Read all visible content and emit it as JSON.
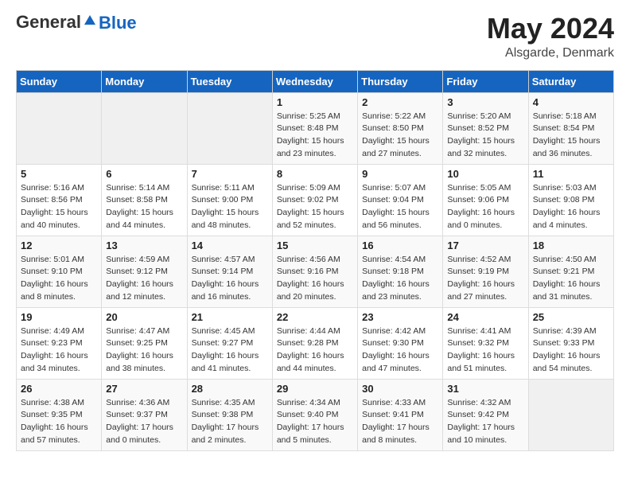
{
  "header": {
    "logo_general": "General",
    "logo_blue": "Blue",
    "month_year": "May 2024",
    "location": "Alsgarde, Denmark"
  },
  "days_of_week": [
    "Sunday",
    "Monday",
    "Tuesday",
    "Wednesday",
    "Thursday",
    "Friday",
    "Saturday"
  ],
  "weeks": [
    [
      {
        "num": "",
        "sunrise": "",
        "sunset": "",
        "daylight": "",
        "empty": true
      },
      {
        "num": "",
        "sunrise": "",
        "sunset": "",
        "daylight": "",
        "empty": true
      },
      {
        "num": "",
        "sunrise": "",
        "sunset": "",
        "daylight": "",
        "empty": true
      },
      {
        "num": "1",
        "sunrise": "Sunrise: 5:25 AM",
        "sunset": "Sunset: 8:48 PM",
        "daylight": "Daylight: 15 hours and 23 minutes.",
        "empty": false
      },
      {
        "num": "2",
        "sunrise": "Sunrise: 5:22 AM",
        "sunset": "Sunset: 8:50 PM",
        "daylight": "Daylight: 15 hours and 27 minutes.",
        "empty": false
      },
      {
        "num": "3",
        "sunrise": "Sunrise: 5:20 AM",
        "sunset": "Sunset: 8:52 PM",
        "daylight": "Daylight: 15 hours and 32 minutes.",
        "empty": false
      },
      {
        "num": "4",
        "sunrise": "Sunrise: 5:18 AM",
        "sunset": "Sunset: 8:54 PM",
        "daylight": "Daylight: 15 hours and 36 minutes.",
        "empty": false
      }
    ],
    [
      {
        "num": "5",
        "sunrise": "Sunrise: 5:16 AM",
        "sunset": "Sunset: 8:56 PM",
        "daylight": "Daylight: 15 hours and 40 minutes.",
        "empty": false
      },
      {
        "num": "6",
        "sunrise": "Sunrise: 5:14 AM",
        "sunset": "Sunset: 8:58 PM",
        "daylight": "Daylight: 15 hours and 44 minutes.",
        "empty": false
      },
      {
        "num": "7",
        "sunrise": "Sunrise: 5:11 AM",
        "sunset": "Sunset: 9:00 PM",
        "daylight": "Daylight: 15 hours and 48 minutes.",
        "empty": false
      },
      {
        "num": "8",
        "sunrise": "Sunrise: 5:09 AM",
        "sunset": "Sunset: 9:02 PM",
        "daylight": "Daylight: 15 hours and 52 minutes.",
        "empty": false
      },
      {
        "num": "9",
        "sunrise": "Sunrise: 5:07 AM",
        "sunset": "Sunset: 9:04 PM",
        "daylight": "Daylight: 15 hours and 56 minutes.",
        "empty": false
      },
      {
        "num": "10",
        "sunrise": "Sunrise: 5:05 AM",
        "sunset": "Sunset: 9:06 PM",
        "daylight": "Daylight: 16 hours and 0 minutes.",
        "empty": false
      },
      {
        "num": "11",
        "sunrise": "Sunrise: 5:03 AM",
        "sunset": "Sunset: 9:08 PM",
        "daylight": "Daylight: 16 hours and 4 minutes.",
        "empty": false
      }
    ],
    [
      {
        "num": "12",
        "sunrise": "Sunrise: 5:01 AM",
        "sunset": "Sunset: 9:10 PM",
        "daylight": "Daylight: 16 hours and 8 minutes.",
        "empty": false
      },
      {
        "num": "13",
        "sunrise": "Sunrise: 4:59 AM",
        "sunset": "Sunset: 9:12 PM",
        "daylight": "Daylight: 16 hours and 12 minutes.",
        "empty": false
      },
      {
        "num": "14",
        "sunrise": "Sunrise: 4:57 AM",
        "sunset": "Sunset: 9:14 PM",
        "daylight": "Daylight: 16 hours and 16 minutes.",
        "empty": false
      },
      {
        "num": "15",
        "sunrise": "Sunrise: 4:56 AM",
        "sunset": "Sunset: 9:16 PM",
        "daylight": "Daylight: 16 hours and 20 minutes.",
        "empty": false
      },
      {
        "num": "16",
        "sunrise": "Sunrise: 4:54 AM",
        "sunset": "Sunset: 9:18 PM",
        "daylight": "Daylight: 16 hours and 23 minutes.",
        "empty": false
      },
      {
        "num": "17",
        "sunrise": "Sunrise: 4:52 AM",
        "sunset": "Sunset: 9:19 PM",
        "daylight": "Daylight: 16 hours and 27 minutes.",
        "empty": false
      },
      {
        "num": "18",
        "sunrise": "Sunrise: 4:50 AM",
        "sunset": "Sunset: 9:21 PM",
        "daylight": "Daylight: 16 hours and 31 minutes.",
        "empty": false
      }
    ],
    [
      {
        "num": "19",
        "sunrise": "Sunrise: 4:49 AM",
        "sunset": "Sunset: 9:23 PM",
        "daylight": "Daylight: 16 hours and 34 minutes.",
        "empty": false
      },
      {
        "num": "20",
        "sunrise": "Sunrise: 4:47 AM",
        "sunset": "Sunset: 9:25 PM",
        "daylight": "Daylight: 16 hours and 38 minutes.",
        "empty": false
      },
      {
        "num": "21",
        "sunrise": "Sunrise: 4:45 AM",
        "sunset": "Sunset: 9:27 PM",
        "daylight": "Daylight: 16 hours and 41 minutes.",
        "empty": false
      },
      {
        "num": "22",
        "sunrise": "Sunrise: 4:44 AM",
        "sunset": "Sunset: 9:28 PM",
        "daylight": "Daylight: 16 hours and 44 minutes.",
        "empty": false
      },
      {
        "num": "23",
        "sunrise": "Sunrise: 4:42 AM",
        "sunset": "Sunset: 9:30 PM",
        "daylight": "Daylight: 16 hours and 47 minutes.",
        "empty": false
      },
      {
        "num": "24",
        "sunrise": "Sunrise: 4:41 AM",
        "sunset": "Sunset: 9:32 PM",
        "daylight": "Daylight: 16 hours and 51 minutes.",
        "empty": false
      },
      {
        "num": "25",
        "sunrise": "Sunrise: 4:39 AM",
        "sunset": "Sunset: 9:33 PM",
        "daylight": "Daylight: 16 hours and 54 minutes.",
        "empty": false
      }
    ],
    [
      {
        "num": "26",
        "sunrise": "Sunrise: 4:38 AM",
        "sunset": "Sunset: 9:35 PM",
        "daylight": "Daylight: 16 hours and 57 minutes.",
        "empty": false
      },
      {
        "num": "27",
        "sunrise": "Sunrise: 4:36 AM",
        "sunset": "Sunset: 9:37 PM",
        "daylight": "Daylight: 17 hours and 0 minutes.",
        "empty": false
      },
      {
        "num": "28",
        "sunrise": "Sunrise: 4:35 AM",
        "sunset": "Sunset: 9:38 PM",
        "daylight": "Daylight: 17 hours and 2 minutes.",
        "empty": false
      },
      {
        "num": "29",
        "sunrise": "Sunrise: 4:34 AM",
        "sunset": "Sunset: 9:40 PM",
        "daylight": "Daylight: 17 hours and 5 minutes.",
        "empty": false
      },
      {
        "num": "30",
        "sunrise": "Sunrise: 4:33 AM",
        "sunset": "Sunset: 9:41 PM",
        "daylight": "Daylight: 17 hours and 8 minutes.",
        "empty": false
      },
      {
        "num": "31",
        "sunrise": "Sunrise: 4:32 AM",
        "sunset": "Sunset: 9:42 PM",
        "daylight": "Daylight: 17 hours and 10 minutes.",
        "empty": false
      },
      {
        "num": "",
        "sunrise": "",
        "sunset": "",
        "daylight": "",
        "empty": true
      }
    ]
  ]
}
